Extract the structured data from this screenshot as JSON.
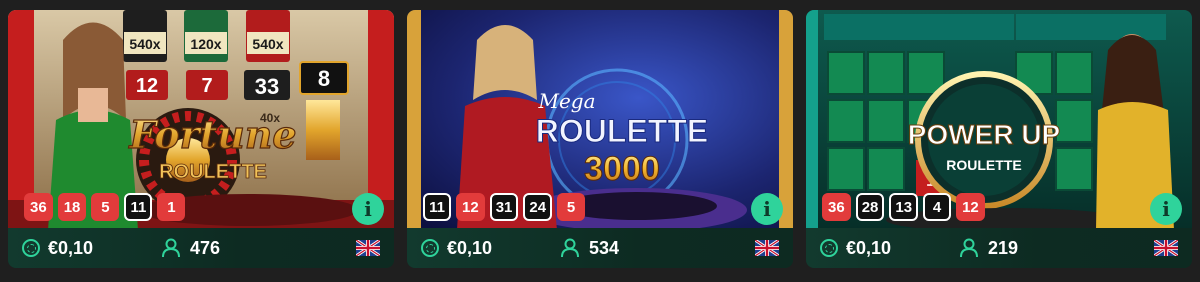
{
  "cards": [
    {
      "name": "Fortune Roulette",
      "logo_line1": "Fortune",
      "logo_line2": "ROULETTE",
      "results": [
        {
          "value": "36",
          "color": "red"
        },
        {
          "value": "18",
          "color": "red"
        },
        {
          "value": "5",
          "color": "red"
        },
        {
          "value": "11",
          "color": "black"
        },
        {
          "value": "1",
          "color": "red"
        }
      ],
      "stake": "€0,10",
      "players": "476",
      "multipliers": [
        "540x",
        "120x",
        "540x"
      ],
      "tiles": [
        "12",
        "7",
        "33",
        "8"
      ],
      "side_mult": "40x"
    },
    {
      "name": "Mega Roulette 3000",
      "logo_line0": "Mega",
      "logo_line1": "ROULETTE",
      "logo_line2": "3000",
      "results": [
        {
          "value": "11",
          "color": "black"
        },
        {
          "value": "12",
          "color": "red"
        },
        {
          "value": "31",
          "color": "black"
        },
        {
          "value": "24",
          "color": "black"
        },
        {
          "value": "5",
          "color": "red"
        }
      ],
      "stake": "€0,10",
      "players": "534"
    },
    {
      "name": "Power Up Roulette",
      "logo_line1": "POWER UP",
      "logo_line2": "ROULETTE",
      "results": [
        {
          "value": "36",
          "color": "red"
        },
        {
          "value": "28",
          "color": "black"
        },
        {
          "value": "13",
          "color": "black"
        },
        {
          "value": "4",
          "color": "black"
        },
        {
          "value": "12",
          "color": "red"
        }
      ],
      "stake": "€0,10",
      "players": "219",
      "table_num": "19"
    }
  ],
  "icons": {
    "stake": "chip-icon",
    "players": "user-icon",
    "flag": "uk-flag-icon",
    "info": "info-icon"
  },
  "info_label": "i",
  "colors": {
    "accent": "#2fd39b",
    "red": "#e23b3b",
    "footer": "#123a2e"
  }
}
